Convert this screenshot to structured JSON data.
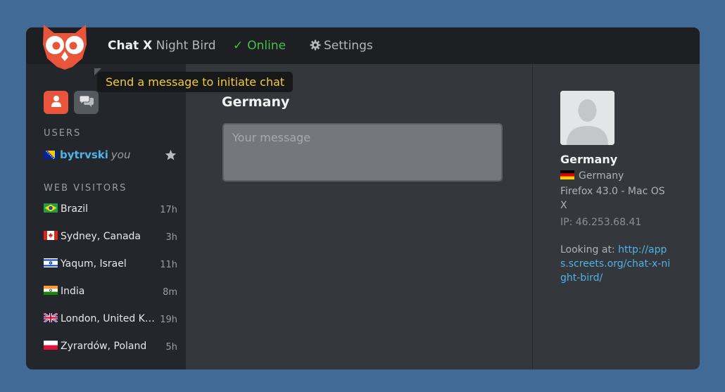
{
  "app": {
    "brand_bold": "Chat X",
    "brand_rest": "Night Bird",
    "status_label": "Online",
    "settings_label": "Settings",
    "logo_icon": "owl-logo-icon",
    "accent_color": "#e9553a",
    "online_color": "#44c24a",
    "link_color": "#4fb3e8"
  },
  "tooltip": {
    "text": "Send a message to initiate chat"
  },
  "sidebar": {
    "users_title": "USERS",
    "visitors_title": "WEB VISITORS",
    "current_user": {
      "name": "bytrvski",
      "tag": "you",
      "flag": "bosnia"
    },
    "visitors": [
      {
        "name": "Brazil",
        "time": "17h",
        "flag": "brazil"
      },
      {
        "name": "Sydney, Canada",
        "time": "3h",
        "flag": "canada"
      },
      {
        "name": "Yaqum, Israel",
        "time": "11h",
        "flag": "israel"
      },
      {
        "name": "India",
        "time": "8m",
        "flag": "india"
      },
      {
        "name": "London, United Kingdom",
        "time": "19h",
        "flag": "uk"
      },
      {
        "name": "Żyrardów, Poland",
        "time": "5h",
        "flag": "poland"
      }
    ]
  },
  "chat": {
    "title": "Germany",
    "placeholder": "Your message"
  },
  "visitor_info": {
    "name": "Germany",
    "country": "Germany",
    "browser": "Firefox 43.0 - Mac OS X",
    "ip": "IP: 46.253.68.41",
    "looking_label": "Looking at:",
    "looking_url": "http://apps.screets.org/chat-x-night-bird/"
  }
}
